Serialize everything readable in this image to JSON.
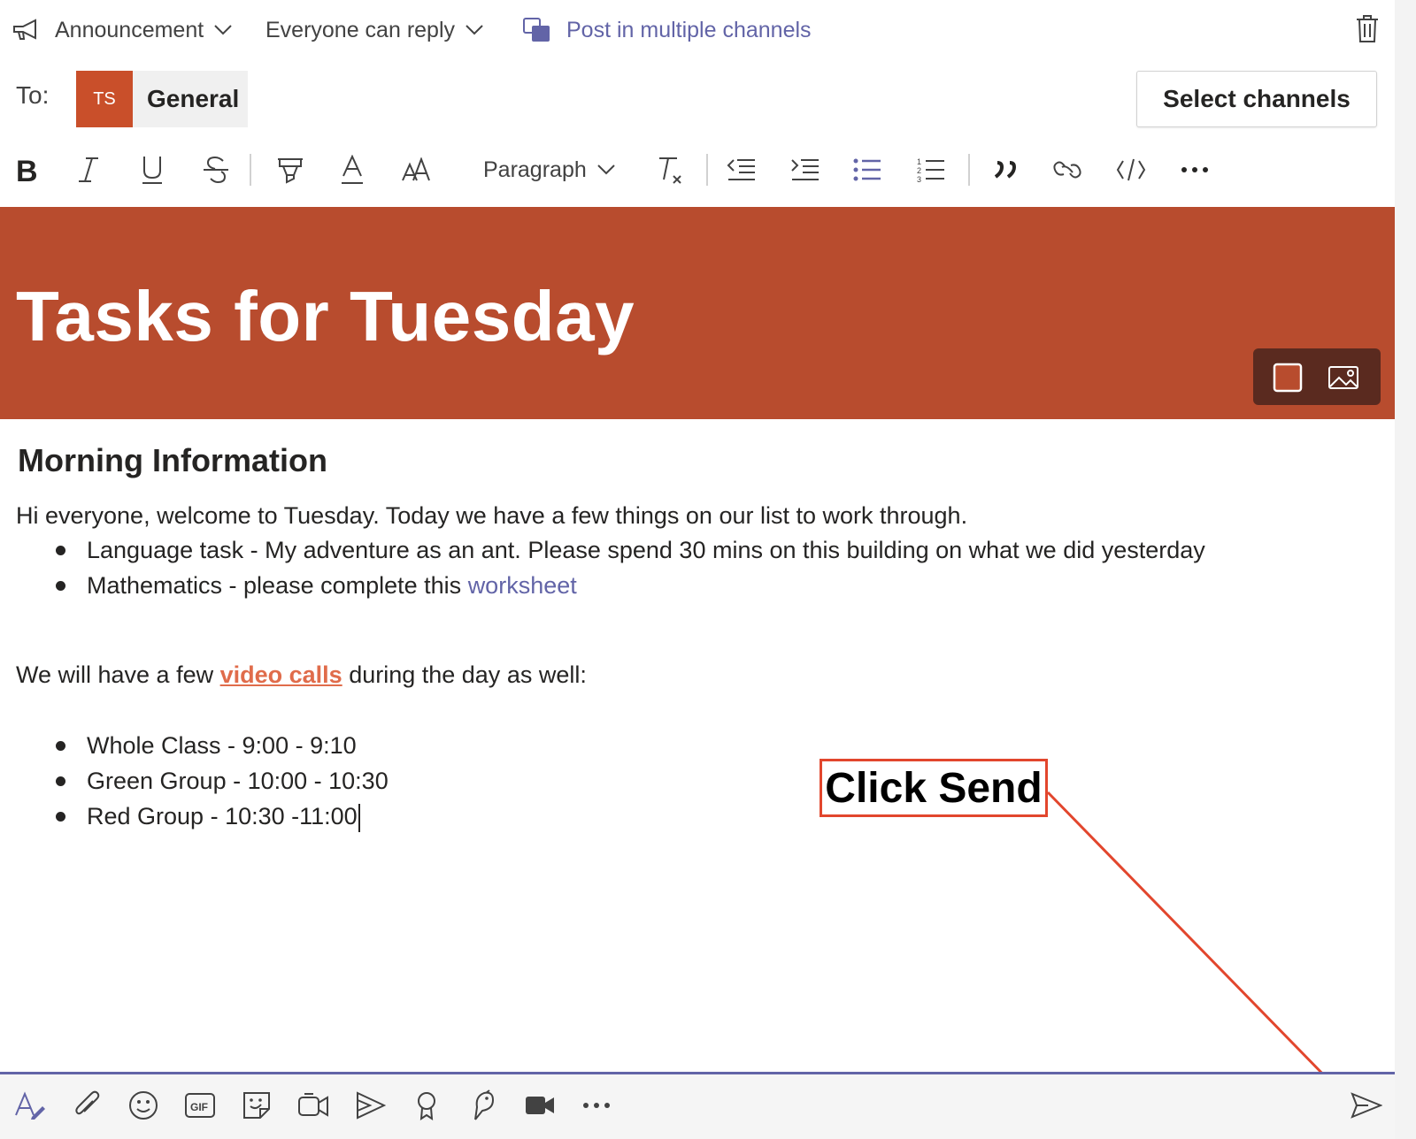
{
  "header": {
    "announcement_label": "Announcement",
    "reply_label": "Everyone can reply",
    "post_multi_label": "Post in multiple channels"
  },
  "to_row": {
    "to_label": "To:",
    "avatar_initials": "TS",
    "channel": "General",
    "select_channels_label": "Select channels"
  },
  "toolbar": {
    "paragraph_label": "Paragraph",
    "icons": [
      "bold-icon",
      "italic-icon",
      "underline-icon",
      "strikethrough-icon",
      "highlight-icon",
      "font-color-icon",
      "font-size-icon",
      "clear-format-icon",
      "decrease-indent-icon",
      "increase-indent-icon",
      "bulleted-list-icon",
      "numbered-list-icon",
      "quote-icon",
      "link-icon",
      "code-icon",
      "more-options-icon"
    ]
  },
  "banner": {
    "title": "Tasks for Tuesday",
    "color": "#b84c2e"
  },
  "content": {
    "heading": "Morning Information",
    "intro": "Hi everyone, welcome to Tuesday. Today we have a few things on our list to work through.",
    "tasks": [
      {
        "text": "Language task - My adventure as an ant. Please spend 30 mins on this building on what we did yesterday"
      },
      {
        "text": "Mathematics - please complete this ",
        "link": "worksheet"
      }
    ],
    "calls_prefix": "We will have a few ",
    "calls_link": "video calls",
    "calls_suffix": " during the day as well:",
    "schedule": [
      "Whole Class - 9:00 - 9:10",
      "Green Group - 10:00 - 10:30",
      "Red Group - 10:30 -11:00"
    ]
  },
  "annotation": {
    "text": "Click Send",
    "color": "#e2462d"
  },
  "bottom_toolbar": {
    "icons": [
      "format-icon",
      "attach-icon",
      "emoji-icon",
      "gif-icon",
      "sticker-icon",
      "meet-now-icon",
      "stream-icon",
      "praise-icon",
      "bird-app-icon",
      "video-icon",
      "more-apps-icon",
      "send-icon"
    ]
  },
  "colors": {
    "accent": "#6264a7",
    "avatar": "#c94f2a"
  }
}
